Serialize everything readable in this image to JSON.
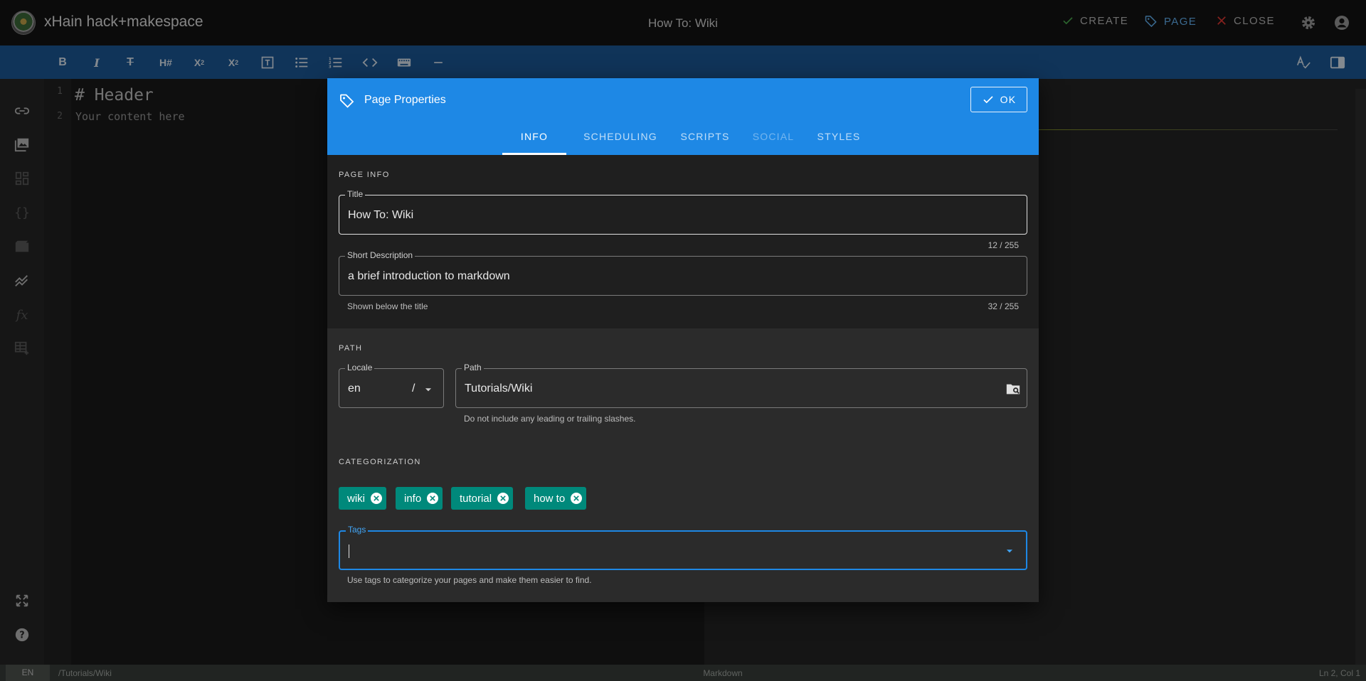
{
  "app": {
    "site_title": "xHain hack+makespace",
    "page_heading": "How To: Wiki"
  },
  "header": {
    "create_label": "CREATE",
    "page_label": "PAGE",
    "close_label": "CLOSE"
  },
  "editor": {
    "line_numbers": [
      "1",
      "2"
    ],
    "lines": [
      "# Header",
      "Your content here"
    ]
  },
  "status": {
    "locale": "EN",
    "path": "/Tutorials/Wiki",
    "mode": "Markdown",
    "position": "Ln 2, Col 1"
  },
  "dialog": {
    "title": "Page Properties",
    "ok_label": "OK",
    "tabs": [
      "INFO",
      "SCHEDULING",
      "SCRIPTS",
      "SOCIAL",
      "STYLES"
    ],
    "active_tab": "INFO",
    "page_info": {
      "section_label": "PAGE INFO",
      "title_label": "Title",
      "title_value": "How To: Wiki",
      "title_counter": "12 / 255",
      "desc_label": "Short Description",
      "desc_value": "a brief introduction to markdown",
      "desc_hint": "Shown below the title",
      "desc_counter": "32 / 255"
    },
    "path": {
      "section_label": "PATH",
      "locale_label": "Locale",
      "locale_value": "en",
      "separator": "/",
      "path_label": "Path",
      "path_value": "Tutorials/Wiki",
      "path_hint": "Do not include any leading or trailing slashes."
    },
    "categorization": {
      "section_label": "CATEGORIZATION",
      "tags": [
        "wiki",
        "info",
        "tutorial",
        "how to"
      ],
      "tags_label": "Tags",
      "tags_hint": "Use tags to categorize your pages and make them easier to find."
    }
  },
  "colors": {
    "accent": "#1e88e5",
    "toolbar": "#1d5a9a",
    "chip": "#00897b",
    "topbar": "#141414"
  }
}
